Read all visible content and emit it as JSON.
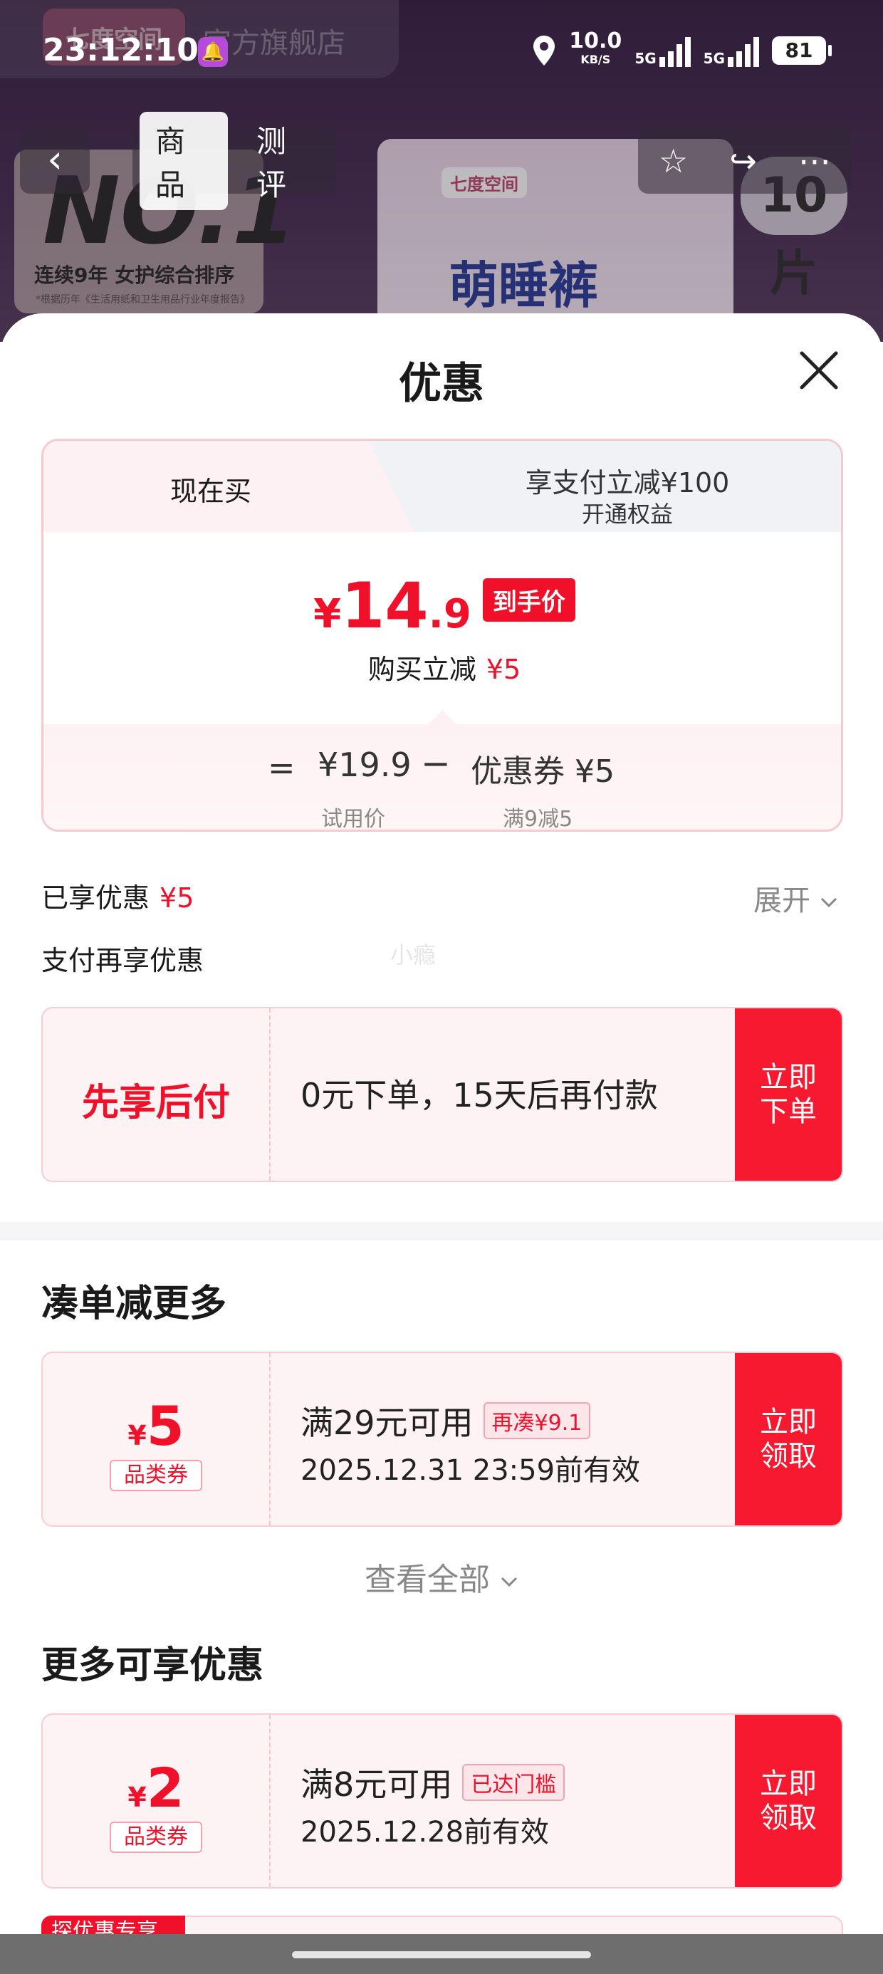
{
  "status_bar": {
    "time": "23:12:10",
    "net_speed": "10.0",
    "net_unit": "KB/S",
    "sig1_label": "5G",
    "sig2_label": "5G",
    "battery": "81",
    "icons": [
      "bell-notification-icon",
      "location-icon",
      "signal-icon",
      "battery-icon"
    ]
  },
  "background_page": {
    "brand_logo": "七度空间",
    "brand_name": "官方旗舰店",
    "nav_tabs": [
      "商品",
      "测评"
    ],
    "active_tab": "商品",
    "product_brand": "七度空间",
    "product_title": "萌睡裤",
    "no1": "NO.1",
    "no1_sub": "连续9年 女护综合排序",
    "no1_note": "*根据历年《生活用纸和卫生用品行业年度报告》",
    "pieces": "10片"
  },
  "sheet": {
    "title": "优惠",
    "tabs": {
      "now_buy": "现在买",
      "pay_title": "享支付立减¥100",
      "pay_sub": "开通权益"
    },
    "final_price": {
      "yen": "¥",
      "int": "14",
      "dec": ".9",
      "badge": "到手价"
    },
    "reduce_label": "购买立减",
    "reduce_value": "¥5",
    "breakdown": {
      "eq": "=",
      "trial_price": "¥19.9",
      "trial_label": "试用价",
      "minus": "−",
      "coupon": "优惠券 ¥5",
      "coupon_label": "满9减5"
    },
    "enjoyed_label": "已享优惠",
    "enjoyed_value": "¥5",
    "expand": "展开",
    "pay_more": "支付再享优惠",
    "watermark": "小瘾",
    "bnpl": {
      "title": "先享后付",
      "desc": "0元下单，15天后再付款",
      "button": "立即\n下单"
    },
    "section1_title": "凑单减更多",
    "coupon1": {
      "yen": "¥",
      "amount": "5",
      "tag": "品类券",
      "condition": "满29元可用",
      "cond_tag": "再凑¥9.1",
      "expiry": "2025.12.31 23:59前有效",
      "button": "立即\n领取"
    },
    "view_all": "查看全部",
    "section2_title": "更多可享优惠",
    "coupon2": {
      "yen": "¥",
      "amount": "2",
      "tag": "品类券",
      "condition": "满8元可用",
      "cond_tag": "已达门槛",
      "expiry": "2025.12.28前有效",
      "button": "立即\n领取"
    },
    "partial_tag": "探优惠专享"
  },
  "colors": {
    "accent_red": "#f0102a",
    "button_red": "#f61930",
    "card_pink": "#fdf3f4",
    "border_pink": "#f8cdd3"
  }
}
